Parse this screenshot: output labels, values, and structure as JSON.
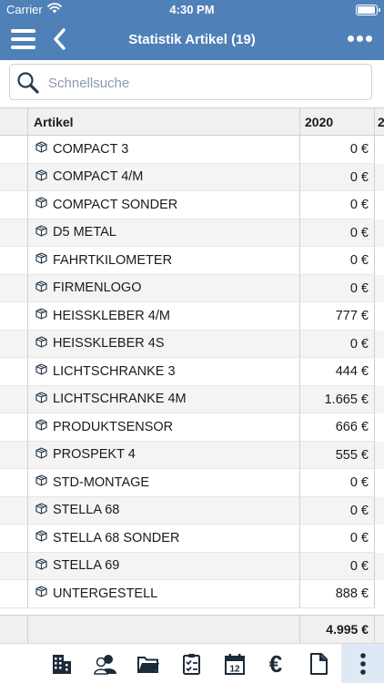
{
  "status": {
    "carrier": "Carrier",
    "time": "4:30 PM"
  },
  "nav": {
    "title": "Statistik Artikel (19)"
  },
  "search": {
    "placeholder": "Schnellsuche"
  },
  "table": {
    "headers": {
      "artikel": "Artikel",
      "year": "2020",
      "next_year": "2"
    },
    "rows": [
      {
        "name": "COMPACT 3",
        "value": "0 €"
      },
      {
        "name": "COMPACT 4/M",
        "value": "0 €"
      },
      {
        "name": "COMPACT SONDER",
        "value": "0 €"
      },
      {
        "name": "D5 METAL",
        "value": "0 €"
      },
      {
        "name": "FAHRTKILOMETER",
        "value": "0 €"
      },
      {
        "name": "FIRMENLOGO",
        "value": "0 €"
      },
      {
        "name": "HEISSKLEBER 4/M",
        "value": "777 €"
      },
      {
        "name": "HEISSKLEBER 4S",
        "value": "0 €"
      },
      {
        "name": "LICHTSCHRANKE 3",
        "value": "444 €"
      },
      {
        "name": "LICHTSCHRANKE 4M",
        "value": "1.665 €"
      },
      {
        "name": "PRODUKTSENSOR",
        "value": "666 €"
      },
      {
        "name": "PROSPEKT 4",
        "value": "555 €"
      },
      {
        "name": "STD-MONTAGE",
        "value": "0 €"
      },
      {
        "name": "STELLA 68",
        "value": "0 €"
      },
      {
        "name": "STELLA 68 SONDER",
        "value": "0 €"
      },
      {
        "name": "STELLA 69",
        "value": "0 €"
      },
      {
        "name": "UNTERGESTELL",
        "value": "888 €"
      }
    ],
    "total": "4.995 €"
  },
  "tabbar": {
    "calendar_day": "12",
    "euro_glyph": "€",
    "icons": [
      "building-icon",
      "users-icon",
      "folder-icon",
      "clipboard-check-icon",
      "calendar-icon",
      "euro-icon",
      "document-icon",
      "more-vertical-icon"
    ],
    "active": "more-vertical-icon"
  },
  "colors": {
    "header_bg": "#4f80b8",
    "icon_dark": "#1c2b3a",
    "active_tab_bg": "#dfe9f5"
  }
}
